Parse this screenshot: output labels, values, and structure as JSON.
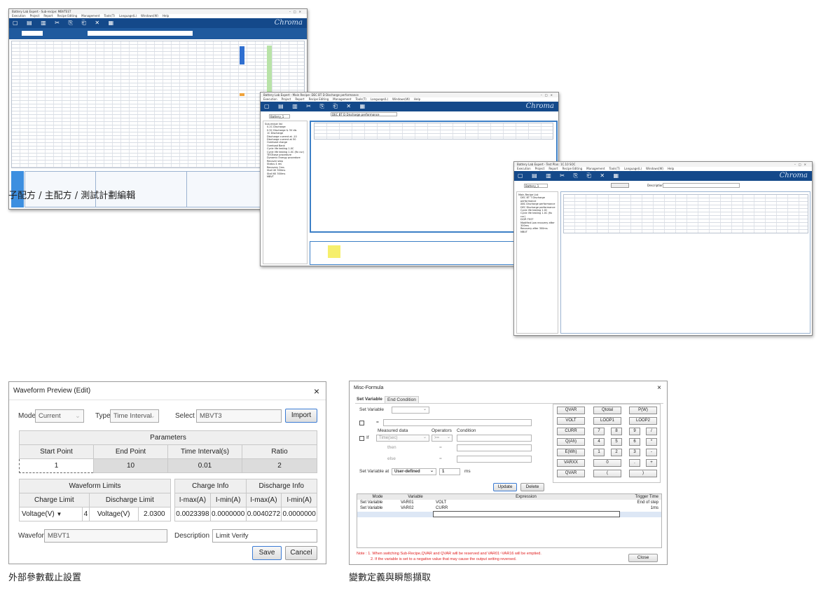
{
  "brand": "Chroma",
  "captions": {
    "top": "子配方 / 主配方 / 測試計劃編輯",
    "bottom_left": "外部參數截止設置",
    "bottom_right": "變數定義與瞬態擷取"
  },
  "waveform_dialog": {
    "title": "Waveform Preview (Edit)",
    "close": "×",
    "mode_label": "Mode",
    "mode_value": "Current",
    "type_label": "Type",
    "type_value": "Time Interval",
    "select_file_label": "Select file",
    "select_file_value": "MBVT3",
    "import_button": "Import",
    "parameters_title": "Parameters",
    "param_headers": [
      "Start Point",
      "End Point",
      "Time Interval(s)",
      "Ratio"
    ],
    "param_values": [
      "1",
      "10",
      "0.01",
      "2"
    ],
    "limits_title": "Waveform Limits",
    "charge_limit": "Charge Limit",
    "discharge_limit": "Discharge Limit",
    "charge_limit_type": "Voltage(V)",
    "charge_limit_value": "4",
    "discharge_limit_type": "Voltage(V)",
    "discharge_limit_value": "2.0300",
    "charge_info": "Charge Info",
    "discharge_info": "Discharge Info",
    "info_headers": [
      "I-max(A)",
      "I-min(A)",
      "I-max(A)",
      "I-min(A)"
    ],
    "info_values": [
      "0.0023398",
      "0.0000000",
      "0.0040272",
      "0.0000000"
    ],
    "waveform_label": "Waveform",
    "waveform_value": "MBVT1",
    "description_label": "Description",
    "description_value": "Limit Verify",
    "save_button": "Save",
    "cancel_button": "Cancel"
  },
  "misc_formula": {
    "title": "Misc-Formula",
    "close": "×",
    "tabs": [
      "Set Variable",
      "End Condition"
    ],
    "set_variable_label": "Set Variable",
    "equals": "=",
    "if_label": "If",
    "measured_data_label": "Measured data",
    "operators_label": "Operators",
    "condition_label": "Condition",
    "measured_value": "Time(sec)",
    "operator_value": ">=",
    "then_label": "then",
    "else_label": "else",
    "set_variable_at_label": "Set Variable at",
    "set_at_value": "User-defined",
    "set_at_number": "1",
    "unit": "ms",
    "update_button": "Update",
    "delete_button": "Delete",
    "keypad": [
      "QVAR",
      "Qtotal",
      "P(W)",
      "VOLT",
      "LOOP1",
      "LOOP2",
      "CURR",
      "7",
      "8",
      "9",
      "/",
      "Q(Ah)",
      "4",
      "5",
      "6",
      "*",
      "E(Wh)",
      "1",
      "2",
      "3",
      "-",
      "VARXX",
      "0",
      ".",
      "+",
      "QVAR",
      "(",
      ")"
    ],
    "table_headers": [
      "Mode",
      "Variable",
      "Expression",
      "Trigger Time"
    ],
    "rows": [
      [
        "Set Variable",
        "VAR01",
        "VOLT",
        "End of step"
      ],
      [
        "Set Variable",
        "VAR02",
        "CURR",
        "1ms"
      ]
    ],
    "note1": "Note : 1. When switching Sub-Recipe,QVAR and QVAR will be reserved and VAR01~VAR16 will be emptied.",
    "note2": "2. If the variable is set to a negative value that may cause the output setting reversed.",
    "close_button": "Close"
  },
  "app_windows": {
    "w1_title": "Battery Lab Expert - Sub-recipe: MBVTEST",
    "w2_title": "Battery Lab Expert - Main Recipe: DEC BT D Discharge performance",
    "w3_title": "Battery Lab Expert - Test Plan: 1C.10 SOC",
    "menu": [
      "Execution",
      "Project",
      "Report",
      "Recipe Editing",
      "Management",
      "Tools(T)",
      "Language(L)",
      "Windows(W)",
      "Help"
    ],
    "w2_description": "DEC BT D Discharge performance",
    "w2_project": "Battery_1",
    "w3_project": "Battery_1",
    "w3_description_label": "Description",
    "w2_tree": [
      "Sub-recipe list",
      "0.2C Discharge",
      "0.5C Discharge & 3V dis",
      "1C Discharge",
      "Discharge current at -10",
      "Discharge current at 50",
      "Overload charge",
      "Overload Bank",
      "Cycle life testing 1.0C",
      "Cycle life testing 1.0C (fix cur)",
      "TESTcase procedure",
      "Dynamic Energy procedure",
      "Recover step",
      "Status 4 rev",
      "Recovery 2ms",
      "Stall 40 300ms",
      "Stall 60 300ms",
      "MBVT"
    ],
    "w3_tree": [
      "Main-Recipe List",
      "DEC BT T Discharge performance",
      "ABC Discharge performance",
      "DEC Discharge performance",
      "Cycle life testing 1.0C",
      "Cycle life testing 1.0C (fix cur)",
      "DCIR TEST",
      "Modified Low recovery after 300ms",
      "Recovery after 300ms",
      "MBVT"
    ]
  }
}
